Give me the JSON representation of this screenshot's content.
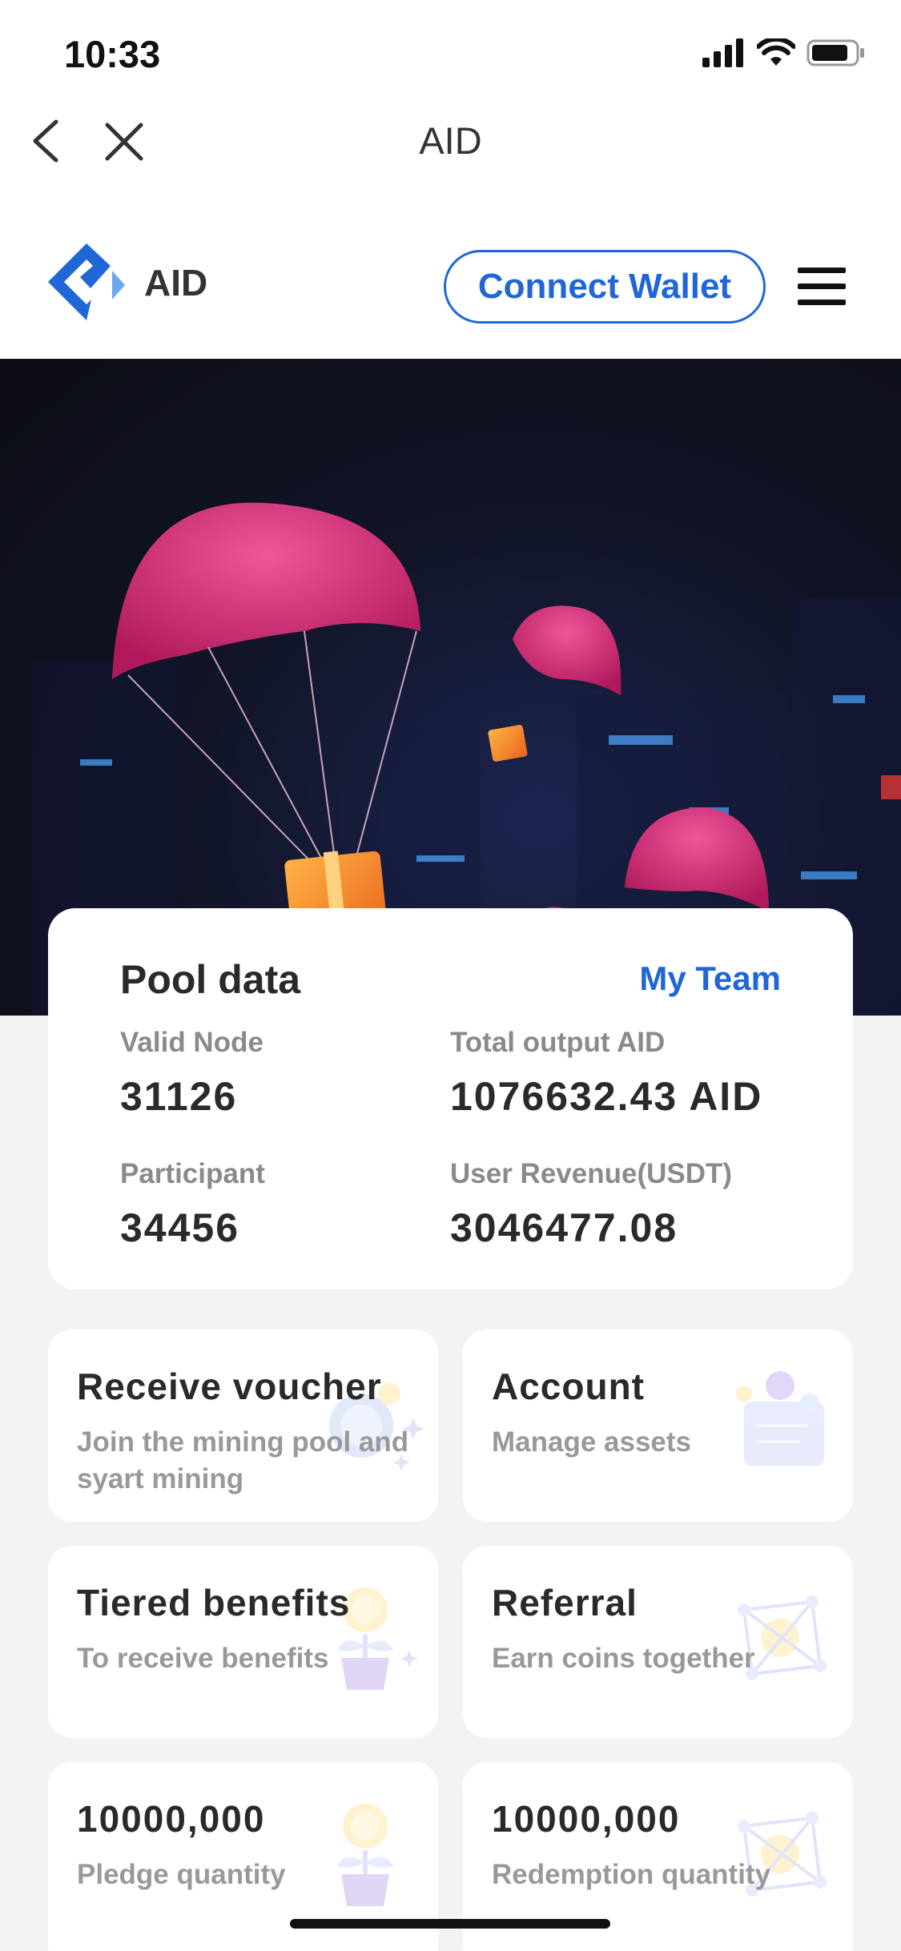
{
  "status_bar": {
    "time": "10:33"
  },
  "nav": {
    "title": "AID"
  },
  "header": {
    "brand": "AID",
    "connect_label": "Connect Wallet"
  },
  "pool": {
    "title": "Pool data",
    "my_team": "My Team",
    "stats": [
      {
        "label": "Valid Node",
        "value": "31126"
      },
      {
        "label": "Total output AID",
        "value": "1076632.43 AID"
      },
      {
        "label": "Participant",
        "value": "34456"
      },
      {
        "label": "User Revenue(USDT)",
        "value": "3046477.08"
      }
    ]
  },
  "tiles": [
    {
      "title": "Receive voucher",
      "subtitle": "Join the mining pool and syart mining",
      "icon": "coin-icon"
    },
    {
      "title": "Account",
      "subtitle": "Manage assets",
      "icon": "wallet-icon"
    },
    {
      "title": "Tiered benefits",
      "subtitle": "To receive benefits",
      "icon": "plant-coin-icon"
    },
    {
      "title": "Referral",
      "subtitle": "Earn coins together",
      "icon": "network-icon"
    },
    {
      "title": "10000,000",
      "subtitle": "Pledge quantity",
      "icon": "plant-coin-icon"
    },
    {
      "title": "10000,000",
      "subtitle": "Redemption quantity",
      "icon": "network-icon"
    }
  ],
  "colors": {
    "accent": "#1f66d6",
    "background": "#f3f3f4"
  }
}
